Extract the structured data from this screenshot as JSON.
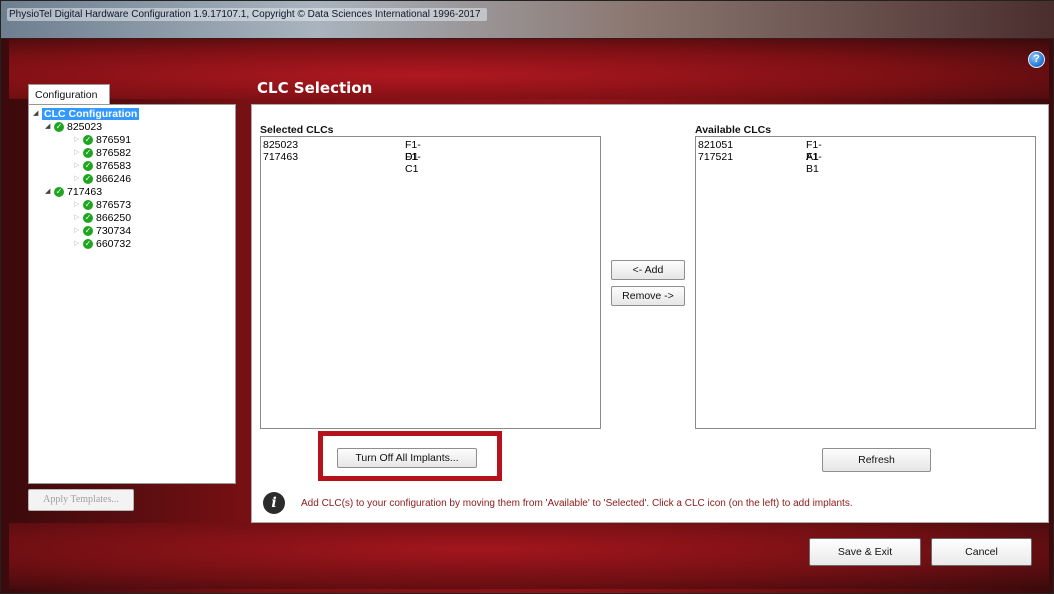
{
  "window": {
    "title": "PhysioTel Digital Hardware Configuration 1.9.17107.1, Copyright © Data Sciences International 1996-2017"
  },
  "left_panel": {
    "tab_label": "Configuration",
    "tree": {
      "root": "CLC Configuration",
      "groups": [
        {
          "id": "825023",
          "children": [
            "876591",
            "876582",
            "876583",
            "866246"
          ]
        },
        {
          "id": "717463",
          "children": [
            "876573",
            "866250",
            "730734",
            "660732"
          ]
        }
      ]
    },
    "apply_templates_label": "Apply Templates..."
  },
  "main": {
    "title": "CLC Selection",
    "selected": {
      "label": "Selected CLCs",
      "rows": [
        {
          "id": "825023",
          "code": "F1-D1"
        },
        {
          "id": "717463",
          "code": "F1-C1"
        }
      ]
    },
    "available": {
      "label": "Available CLCs",
      "rows": [
        {
          "id": "821051",
          "code": "F1-A1"
        },
        {
          "id": "717521",
          "code": "F1-B1"
        }
      ]
    },
    "add_label": "<- Add",
    "remove_label": "Remove ->",
    "turn_off_label": "Turn Off All Implants...",
    "refresh_label": "Refresh",
    "info_text": "Add CLC(s) to your configuration by moving them from 'Available' to 'Selected'.  Click a CLC icon (on the left) to add implants."
  },
  "footer": {
    "save_exit_label": "Save & Exit",
    "cancel_label": "Cancel"
  },
  "colors": {
    "accent_red": "#b5121b",
    "tree_selection": "#3399ff",
    "status_ok": "#1fa51f",
    "info_text": "#8b1a1a"
  },
  "icons": {
    "help": "help-icon",
    "info": "info-icon",
    "status": "check-circle-icon"
  }
}
